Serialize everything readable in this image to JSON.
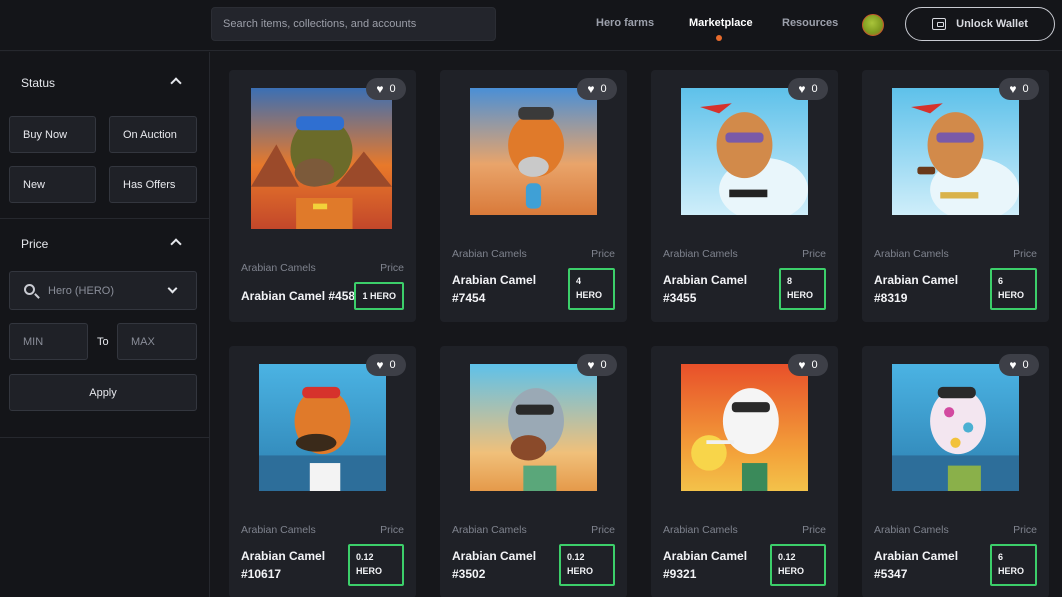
{
  "header": {
    "search_placeholder": "Search items, collections, and accounts",
    "nav": [
      {
        "label": "Hero farms"
      },
      {
        "label": "Marketplace"
      },
      {
        "label": "Resources"
      }
    ],
    "active_nav": "Marketplace",
    "wallet_label": "Unlock Wallet"
  },
  "sidebar": {
    "status_title": "Status",
    "status_filters": [
      "Buy Now",
      "On Auction",
      "New",
      "Has Offers"
    ],
    "price_title": "Price",
    "token_select": "Hero (HERO)",
    "min_placeholder": "MIN",
    "to_label": "To",
    "max_placeholder": "MAX",
    "apply_label": "Apply"
  },
  "items": [
    {
      "collection": "Arabian Camels",
      "price_label": "Price",
      "title_line1": "Arabian Camel #458",
      "title_line2": "",
      "price_line1": "1 HERO",
      "price_line2": "",
      "likes": "0"
    },
    {
      "collection": "Arabian Camels",
      "price_label": "Price",
      "title_line1": "Arabian Camel",
      "title_line2": "#7454",
      "price_line1": "4",
      "price_line2": "HERO",
      "likes": "0"
    },
    {
      "collection": "Arabian Camels",
      "price_label": "Price",
      "title_line1": "Arabian Camel",
      "title_line2": "#3455",
      "price_line1": "8",
      "price_line2": "HERO",
      "likes": "0"
    },
    {
      "collection": "Arabian Camels",
      "price_label": "Price",
      "title_line1": "Arabian Camel",
      "title_line2": "#8319",
      "price_line1": "6",
      "price_line2": "HERO",
      "likes": "0"
    },
    {
      "collection": "Arabian Camels",
      "price_label": "Price",
      "title_line1": "Arabian Camel",
      "title_line2": "#10617",
      "price_line1": "0.12",
      "price_line2": "HERO",
      "likes": "0"
    },
    {
      "collection": "Arabian Camels",
      "price_label": "Price",
      "title_line1": "Arabian Camel",
      "title_line2": "#3502",
      "price_line1": "0.12",
      "price_line2": "HERO",
      "likes": "0"
    },
    {
      "collection": "Arabian Camels",
      "price_label": "Price",
      "title_line1": "Arabian Camel",
      "title_line2": "#9321",
      "price_line1": "0.12",
      "price_line2": "HERO",
      "likes": "0"
    },
    {
      "collection": "Arabian Camels",
      "price_label": "Price",
      "title_line1": "Arabian Camel",
      "title_line2": "#5347",
      "price_line1": "6",
      "price_line2": "HERO",
      "likes": "0"
    }
  ],
  "colors": {
    "accent_dot": "#e86b2c",
    "price_border": "#3ccf6a",
    "card_bg": "#1f2127"
  },
  "icons": [
    "search-icon",
    "wallet-icon",
    "chevron-up-icon",
    "chevron-down-icon",
    "heart-icon"
  ]
}
